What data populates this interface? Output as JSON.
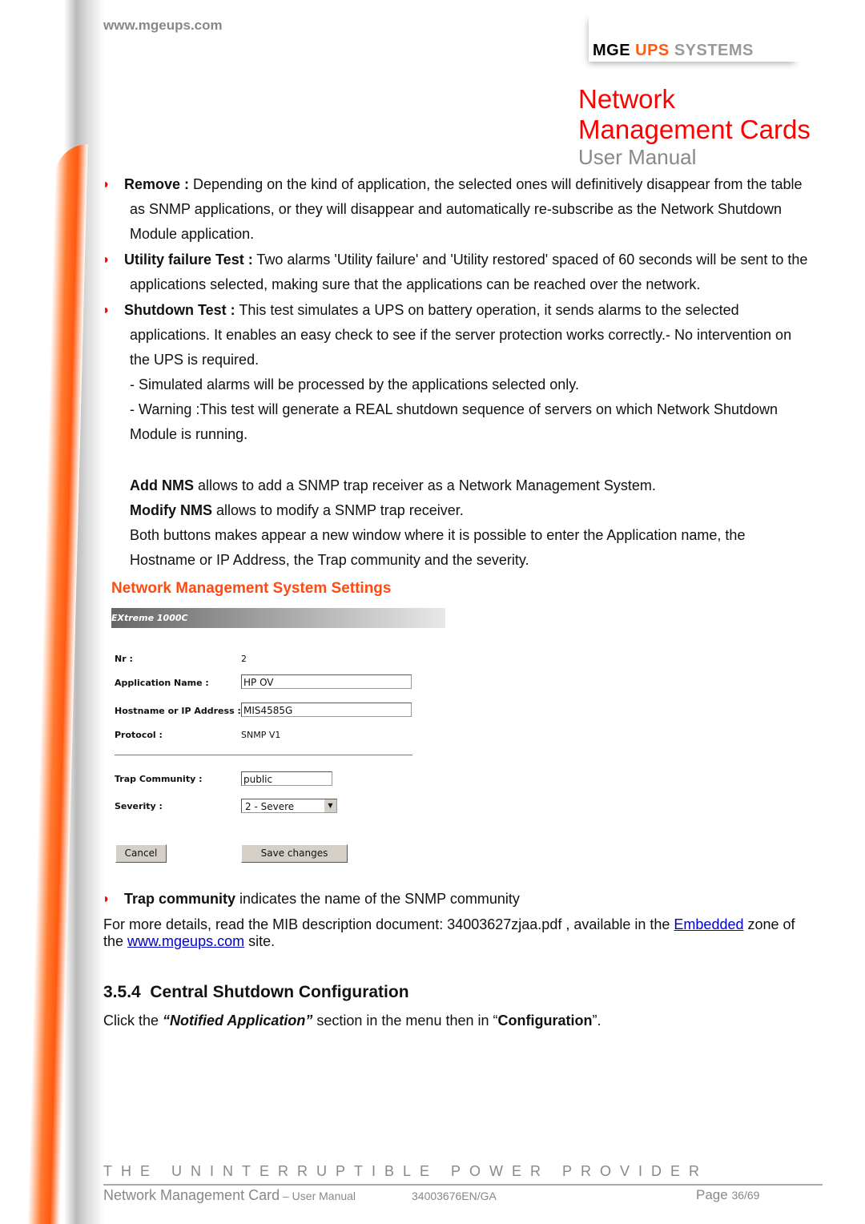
{
  "header": {
    "url": "www.mgeups.com",
    "logo": {
      "mge": "MGE",
      "ups": "UPS",
      "systems": "SYSTEMS"
    },
    "title_line1": "Network",
    "title_line2": "Management Cards",
    "subtitle": "User Manual"
  },
  "bullets": [
    {
      "term": "Remove :",
      "text": " Depending on the kind of application, the selected ones will definitively disappear from the table",
      "cont": [
        "as SNMP applications, or they will disappear and automatically re-subscribe as the Network Shutdown",
        "Module application."
      ]
    },
    {
      "term": "Utility failure Test :",
      "text": " Two alarms 'Utility failure' and 'Utility restored' spaced of 60 seconds will be sent to the",
      "cont": [
        "applications selected, making sure that the applications can be reached over the network."
      ]
    },
    {
      "term": "Shutdown Test :",
      "text": " This test simulates a UPS on battery operation, it sends alarms to the selected",
      "cont": [
        "applications. It enables an easy check to see if the server protection works correctly.- No intervention on",
        "the UPS is required.",
        "- Simulated alarms will be processed by the applications selected only.",
        "- Warning :This test will generate a REAL shutdown sequence of servers on which Network Shutdown",
        "Module is running."
      ]
    }
  ],
  "nms": {
    "add_term": "Add NMS",
    "add_text": " allows to add a SNMP trap receiver as a Network Management System.",
    "modify_term": "Modify NMS",
    "modify_text": " allows to modify a SNMP trap receiver.",
    "both_1": "Both buttons makes appear a new window where it is possible to enter the Application name, the",
    "both_2": "Hostname or IP Address, the Trap community and the severity."
  },
  "section_heading": "Network Management System Settings",
  "form": {
    "header": "EXtreme 1000C",
    "nr_label": "Nr :",
    "nr_value": "2",
    "app_label": "Application Name :",
    "app_value": "HP OV",
    "host_label": "Hostname or IP Address :",
    "host_value": "MIS4585G",
    "protocol_label": "Protocol :",
    "protocol_value": "SNMP V1",
    "trap_label": "Trap Community :",
    "trap_value": "public",
    "severity_label": "Severity :",
    "severity_value": "2 - Severe",
    "cancel": "Cancel",
    "save": "Save changes"
  },
  "trap_bullet": {
    "term": "Trap community",
    "text": " indicates the name of the SNMP community"
  },
  "details": {
    "p1": "For more details, read the MIB description document: 34003627zjaa.pdf , available in the ",
    "link1": "Embedded",
    "p2": " zone of",
    "p3": "the ",
    "link2": "www.mgeups.com",
    "p4": " site."
  },
  "section": {
    "number": "3.5.4",
    "title": "Central Shutdown Configuration",
    "t1": "Click the ",
    "q1": "“Notified Application”",
    "t2": " section in the menu then in “",
    "q2": "Configuration",
    "t3": "”."
  },
  "footer": {
    "tagline": "THE UNINTERRUPTIBLE POWER PROVIDER",
    "doc_title": "Network Management Card",
    "doc_sub": " – User Manual",
    "ref": "34003676EN/GA",
    "page_label": "Page ",
    "page_value": "36/69"
  },
  "colors": {
    "accent": "#ff0000",
    "orange": "#ff4a10"
  }
}
